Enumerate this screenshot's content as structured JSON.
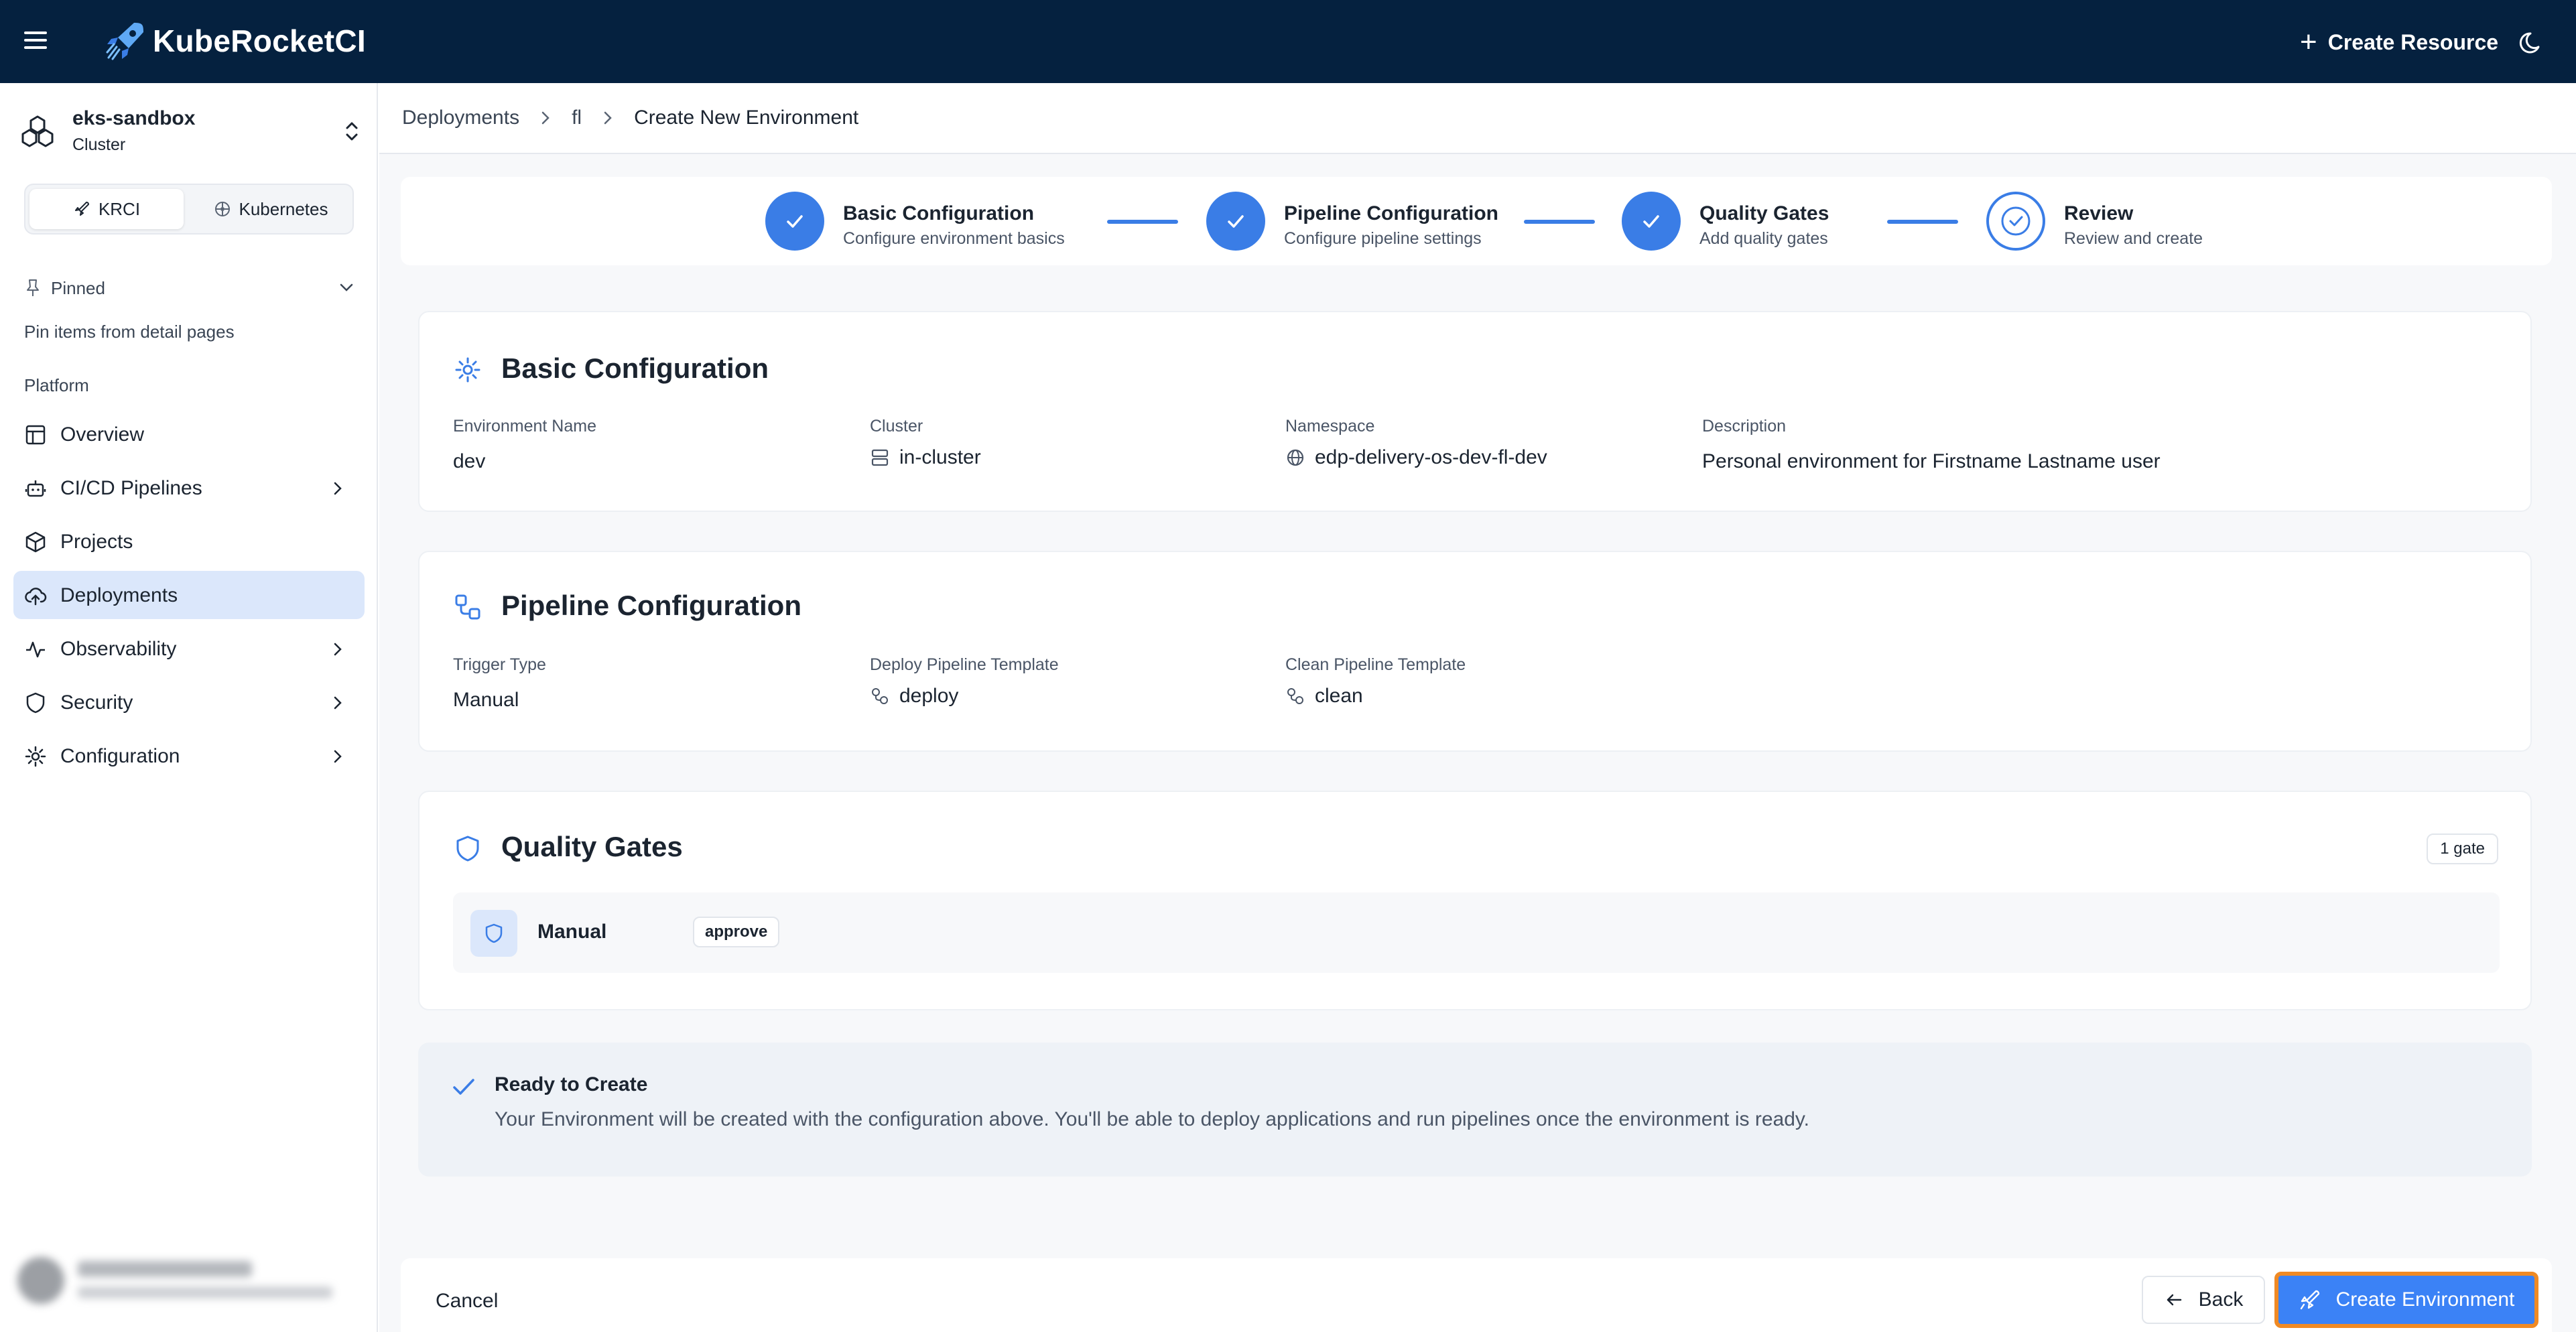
{
  "app": {
    "title": "KubeRocketCI"
  },
  "topbar": {
    "create_resource_label": "Create Resource"
  },
  "cluster": {
    "name": "eks-sandbox",
    "type": "Cluster"
  },
  "mode_switch": {
    "options": [
      "KRCI",
      "Kubernetes"
    ],
    "selected": "KRCI"
  },
  "sidebar": {
    "pinned_label": "Pinned",
    "pinned_hint": "Pin items from detail pages",
    "section_label": "Platform",
    "items": [
      {
        "label": "Overview",
        "icon": "layout-icon"
      },
      {
        "label": "CI/CD Pipelines",
        "icon": "bot-icon"
      },
      {
        "label": "Projects",
        "icon": "box-icon"
      },
      {
        "label": "Deployments",
        "icon": "cloud-upload-icon",
        "active": true
      },
      {
        "label": "Observability",
        "icon": "activity-icon"
      },
      {
        "label": "Security",
        "icon": "shield-icon"
      },
      {
        "label": "Configuration",
        "icon": "gear-icon"
      }
    ]
  },
  "breadcrumb": {
    "items": [
      "Deployments",
      "fl"
    ],
    "current": "Create New Environment"
  },
  "stepper": {
    "steps": [
      {
        "title": "Basic Configuration",
        "subtitle": "Configure environment basics",
        "state": "complete"
      },
      {
        "title": "Pipeline Configuration",
        "subtitle": "Configure pipeline settings",
        "state": "complete"
      },
      {
        "title": "Quality Gates",
        "subtitle": "Add quality gates",
        "state": "complete"
      },
      {
        "title": "Review",
        "subtitle": "Review and create",
        "state": "current"
      }
    ]
  },
  "basic_config": {
    "title": "Basic Configuration",
    "fields": [
      {
        "label": "Environment Name",
        "value": "dev"
      },
      {
        "label": "Cluster",
        "value": "in-cluster"
      },
      {
        "label": "Namespace",
        "value": "edp-delivery-os-dev-fl-dev"
      },
      {
        "label": "Description",
        "value": "Personal environment for Firstname Lastname user"
      }
    ]
  },
  "pipeline_config": {
    "title": "Pipeline Configuration",
    "fields": [
      {
        "label": "Trigger Type",
        "value": "Manual"
      },
      {
        "label": "Deploy Pipeline Template",
        "value": "deploy"
      },
      {
        "label": "Clean Pipeline Template",
        "value": "clean"
      }
    ]
  },
  "quality_gates": {
    "title": "Quality Gates",
    "count_badge": "1 gate",
    "gates": [
      {
        "name": "Manual",
        "type": "approve"
      }
    ]
  },
  "ready": {
    "title": "Ready to Create",
    "text": "Your Environment will be created with the configuration above. You'll be able to deploy applications and run pipelines once the environment is ready."
  },
  "footer": {
    "cancel_label": "Cancel",
    "back_label": "Back",
    "create_label": "Create Environment"
  },
  "colors": {
    "topbar": "#05213f",
    "accent": "#3b82f6",
    "highlight": "#f08a24",
    "active_nav": "#dbe7fb"
  }
}
